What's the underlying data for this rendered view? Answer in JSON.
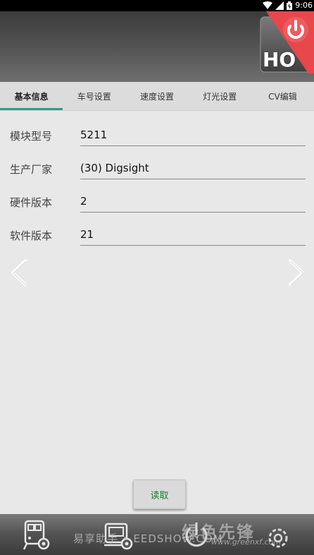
{
  "status_bar": {
    "time": "9:06"
  },
  "header": {
    "ho_label": "HO",
    "accent_color": "#e8474b"
  },
  "tabs": [
    {
      "label": "基本信息",
      "active": true
    },
    {
      "label": "车号设置",
      "active": false
    },
    {
      "label": "速度设置",
      "active": false
    },
    {
      "label": "灯光设置",
      "active": false
    },
    {
      "label": "CV编辑",
      "active": false
    }
  ],
  "form": {
    "fields": [
      {
        "label": "模块型号",
        "value": "5211"
      },
      {
        "label": "生产厂家",
        "value": "(30) Digsight"
      },
      {
        "label": "硬件版本",
        "value": "2"
      },
      {
        "label": "软件版本",
        "value": "21"
      }
    ]
  },
  "read_button": {
    "label": "读取"
  },
  "bottom_nav": {
    "items": [
      "locomotive-settings-icon",
      "controller-settings-icon",
      "power-icon",
      "gear-settings-icon"
    ]
  },
  "watermark": {
    "left_text": "易享助手 • EEDSHOW.COM",
    "brand": "绿色先锋",
    "url": "www.greenxf.com"
  },
  "colors": {
    "tab_indicator": "#2a9d8f",
    "read_button_text": "#1f7a3a"
  }
}
